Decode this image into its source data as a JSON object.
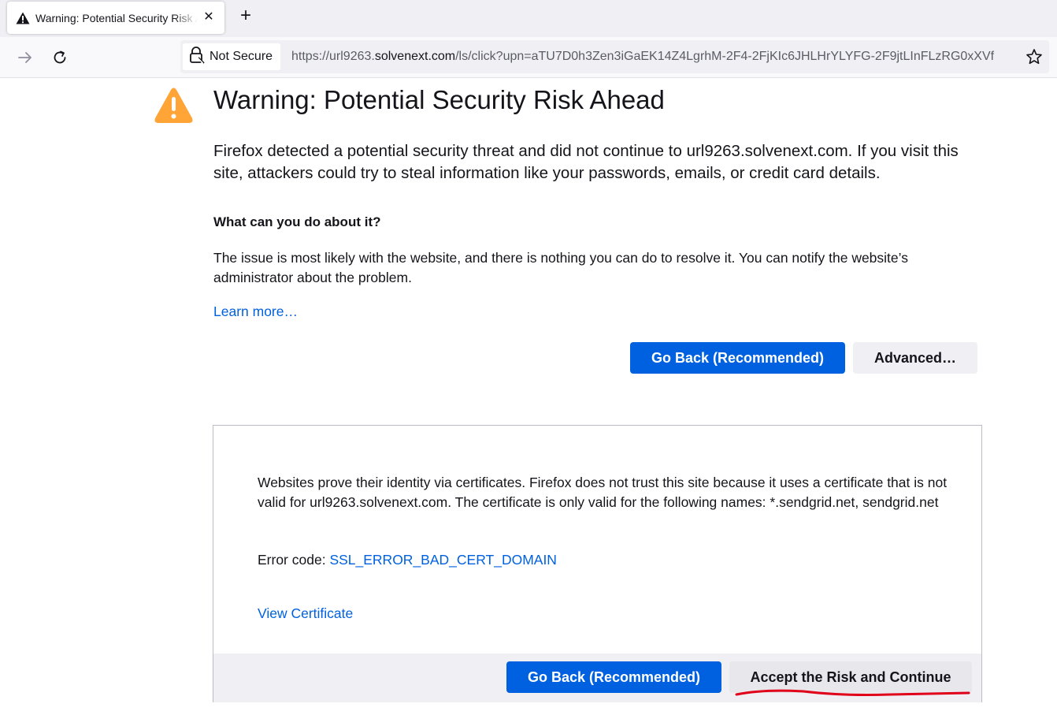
{
  "browser": {
    "tab": {
      "title": "Warning: Potential Security Risk Ahead",
      "close_glyph": "✕"
    },
    "newtab_glyph": "+",
    "urlbar": {
      "identity_label": "Not Secure",
      "url_prefix": "https://url9263.",
      "url_domain": "solvenext.com",
      "url_path": "/ls/click?upn=aTU7D0h3Zen3iGaEK14Z4LgrhM-2F4-2FjKIc6JHLHrYLYFG-2F9jtLInFLzRG0xXVf"
    },
    "icons": [
      "warning-icon",
      "close-icon",
      "plus-icon",
      "forward-icon",
      "reload-icon",
      "insecure-lock-icon",
      "bookmark-star-icon"
    ]
  },
  "page": {
    "title": "Warning: Potential Security Risk Ahead",
    "intro": "Firefox detected a potential security threat and did not continue to url9263.solvenext.com. If you visit this site, attackers could try to steal information like your passwords, emails, or credit card details.",
    "subheading": "What can you do about it?",
    "issue_text": "The issue is most likely with the website, and there is nothing you can do to resolve it. You can notify the website’s administrator about the problem.",
    "learn_more": "Learn more…",
    "go_back_label": "Go Back (Recommended)",
    "advanced_label": "Advanced…",
    "advanced_panel": {
      "explanation": "Websites prove their identity via certificates. Firefox does not trust this site because it uses a certificate that is not valid for url9263.solvenext.com. The certificate is only valid for the following names: *.sendgrid.net, sendgrid.net",
      "error_label": "Error code: ",
      "error_code": "SSL_ERROR_BAD_CERT_DOMAIN",
      "view_certificate": "View Certificate",
      "go_back_label": "Go Back (Recommended)",
      "accept_label": "Accept the Risk and Continue"
    }
  },
  "colors": {
    "accent": "#0061e0",
    "warning": "#ffa436",
    "annotation": "#e0001a"
  }
}
